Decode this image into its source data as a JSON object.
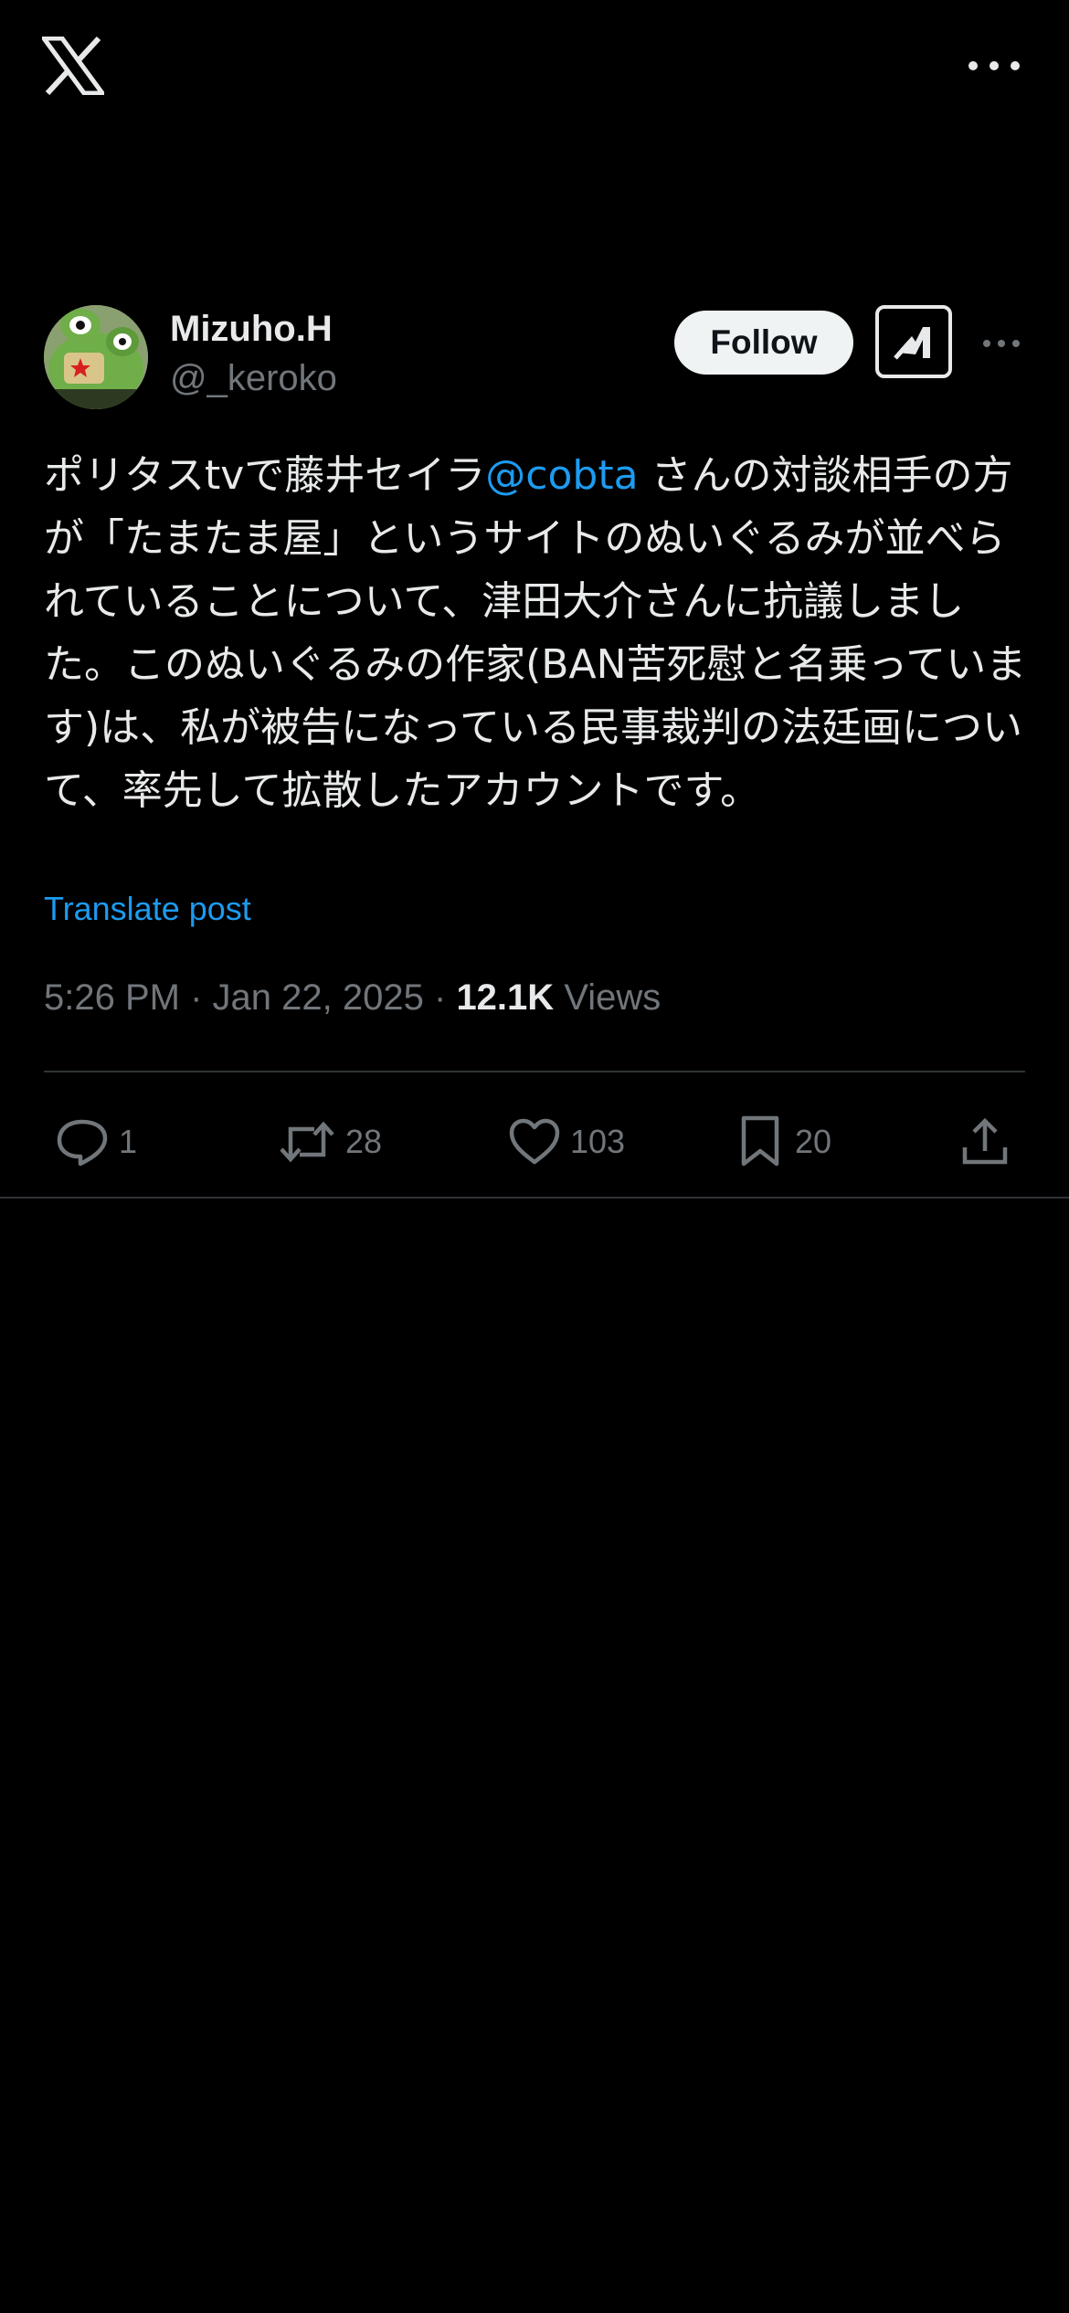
{
  "topbar": {
    "logo_icon": "x-logo-icon",
    "more_icon": "more-horizontal-icon"
  },
  "post": {
    "author": {
      "display_name": "Mizuho.H",
      "handle": "@_keroko"
    },
    "follow_label": "Follow",
    "grok_icon": "grok-icon",
    "text_before_mention": "ポリタスtvで藤井セイラ",
    "mention": "@cobta",
    "text_after_mention": " さんの対談相手の方が「たまたま屋」というサイトのぬいぐるみが並べられていることについて、津田大介さんに抗議しました。このぬいぐるみの作家(BAN苦死慰と名乗っています)は、私が被告になっている民事裁判の法廷画について、率先して拡散したアカウントです。",
    "translate_label": "Translate post",
    "time": "5:26 PM",
    "date": "Jan 22, 2025",
    "separator": "·",
    "views_count": "12.1K",
    "views_label": "Views",
    "actions": {
      "replies": "1",
      "reposts": "28",
      "likes": "103",
      "bookmarks": "20"
    },
    "colors": {
      "accent": "#1d9bf0",
      "text": "#e7e9ea",
      "secondary": "#71767b",
      "background": "#000000",
      "border": "#2f3336"
    }
  }
}
